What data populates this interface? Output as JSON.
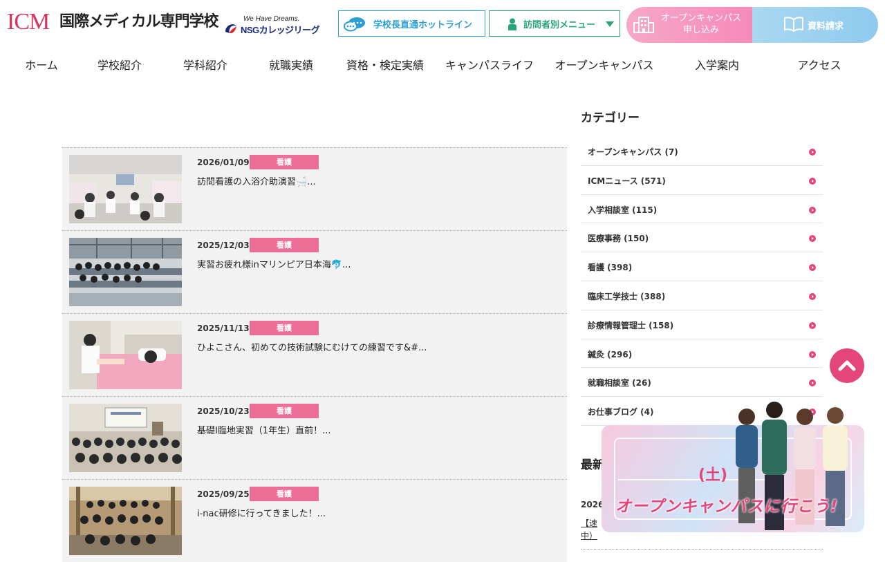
{
  "header": {
    "logo_icm": "ICM",
    "logo_jp": "国際メディカル専門学校",
    "nsg_tagline": "We Have Dreams.",
    "nsg_name": "NSGカレッジリーグ",
    "hotline_label": "学校長直通ホットライン",
    "visitor_menu_label": "訪問者別メニュー",
    "open_campus_line1": "オープンキャンパス",
    "open_campus_line2": "申し込み",
    "document_request_label": "資料請求"
  },
  "nav": {
    "items": [
      "ホーム",
      "学校紹介",
      "学科紹介",
      "就職実績",
      "資格・検定実績",
      "キャンパスライフ",
      "オープンキャンパス",
      "入学案内",
      "アクセス"
    ]
  },
  "posts": [
    {
      "date": "2026/01/09",
      "category": "看護",
      "title": "訪問看護の入浴介助演習🛁..."
    },
    {
      "date": "2025/12/03",
      "category": "看護",
      "title": "実習お疲れ様inマリンピア日本海🐬..."
    },
    {
      "date": "2025/11/13",
      "category": "看護",
      "title": "ひよこさん、初めての技術試験にむけての練習です&#..."
    },
    {
      "date": "2025/10/23",
      "category": "看護",
      "title": "基礎Ⅰ臨地実習（1年生）直前！..."
    },
    {
      "date": "2025/09/25",
      "category": "看護",
      "title": "i-nac研修に行ってきました！..."
    }
  ],
  "sidebar": {
    "category_title": "カテゴリー",
    "categories": [
      "オープンキャンパス (7)",
      "ICMニュース (571)",
      "入学相談室 (115)",
      "医療事務 (150)",
      "看護 (398)",
      "臨床工学技士 (388)",
      "診療情報管理士 (158)",
      "鍼灸 (296)",
      "就職相談室 (26)",
      "お仕事ブログ (4)"
    ],
    "recent_title": "最新",
    "recent_date": "2026",
    "recent_link_1": "【速",
    "recent_link_2": "中）"
  },
  "banner": {
    "saturday": "(土)",
    "text": "オープンキャンパスに行こう!"
  },
  "colors": {
    "accent_pink": "#e4457b",
    "category_pink": "#ec6d95",
    "hotline_blue": "#2b9fd4",
    "visitor_green": "#2aa57a"
  }
}
